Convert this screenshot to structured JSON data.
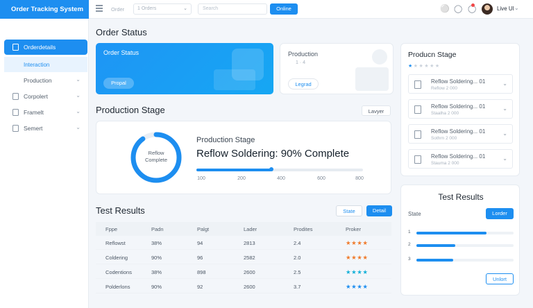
{
  "topbar": {
    "brand": "Order Tracking System",
    "filter_label": "Order",
    "select_value": "1 Orders",
    "search_placeholder": "Search",
    "action_button": "Online",
    "user_name": "Live UI"
  },
  "sidebar": {
    "items": [
      {
        "label": "Orderdetails"
      },
      {
        "label": "Production"
      },
      {
        "label": "Corpolert"
      },
      {
        "label": "Framelt"
      },
      {
        "label": "Semert"
      }
    ],
    "sub_item": "Interaction"
  },
  "order_status": {
    "heading": "Order Status",
    "hero_label": "Order Status",
    "hero_button": "Propal",
    "mini_label": "Production",
    "mini_sub": "1 · 4",
    "mini_button": "Legrad"
  },
  "production_stage": {
    "heading": "Production Stage",
    "layer_button": "Lavyer",
    "ring_text_1": "Reflow",
    "ring_text_2": "Complete",
    "ring_progress": 0.9,
    "label": "Production Stage",
    "status": "Reflow Soldering: 90% Complete",
    "progress": 0.45,
    "ticks": [
      "100",
      "200",
      "400",
      "600",
      "800"
    ]
  },
  "test_results": {
    "heading": "Test Results",
    "seg_a": "State",
    "seg_b": "Detail",
    "columns": [
      "Fppe",
      "Padn",
      "Palgt",
      "Lader",
      "Prodites",
      "Proker"
    ],
    "rows": [
      {
        "c": [
          "Reflowst",
          "38%",
          "94",
          "2813",
          "2.4"
        ],
        "stars": "★★★★",
        "star_color": "#f07a2a"
      },
      {
        "c": [
          "Coldering",
          "90%",
          "96",
          "2582",
          "2.0"
        ],
        "stars": "★★★★",
        "star_color": "#f07a2a"
      },
      {
        "c": [
          "Codentions",
          "38%",
          "898",
          "2600",
          "2.5"
        ],
        "stars": "★★★★",
        "star_color": "#12b0d8"
      },
      {
        "c": [
          "Polderlons",
          "90%",
          "92",
          "2600",
          "3.7"
        ],
        "stars": "★★★★",
        "star_color": "#1d8ef0"
      }
    ]
  },
  "right_stage": {
    "title": "Producn Stage",
    "rating_filled": "★",
    "rating_empty": "★★★★★",
    "items": [
      {
        "t1": "Reflow Soldering... 01",
        "t2": "Reflow 2 000"
      },
      {
        "t1": "Reflow Soldering... 01",
        "t2": "Staalha 2 000"
      },
      {
        "t1": "Reflow Soldering... 01",
        "t2": "Sothrn 2 000"
      },
      {
        "t1": "Reflow Soldering... 01",
        "t2": "Stauma 2 000"
      }
    ]
  },
  "right_tests": {
    "title": "Test Results",
    "state_label": "State",
    "button": "Lorder",
    "bars": [
      {
        "num": "1",
        "value": 0.72
      },
      {
        "num": "2",
        "value": 0.4
      },
      {
        "num": "3",
        "value": 0.38
      }
    ],
    "footer_button": "Unlort"
  },
  "colors": {
    "accent": "#1d8ef0",
    "star_orange": "#f07a2a",
    "star_teal": "#12b0d8"
  }
}
